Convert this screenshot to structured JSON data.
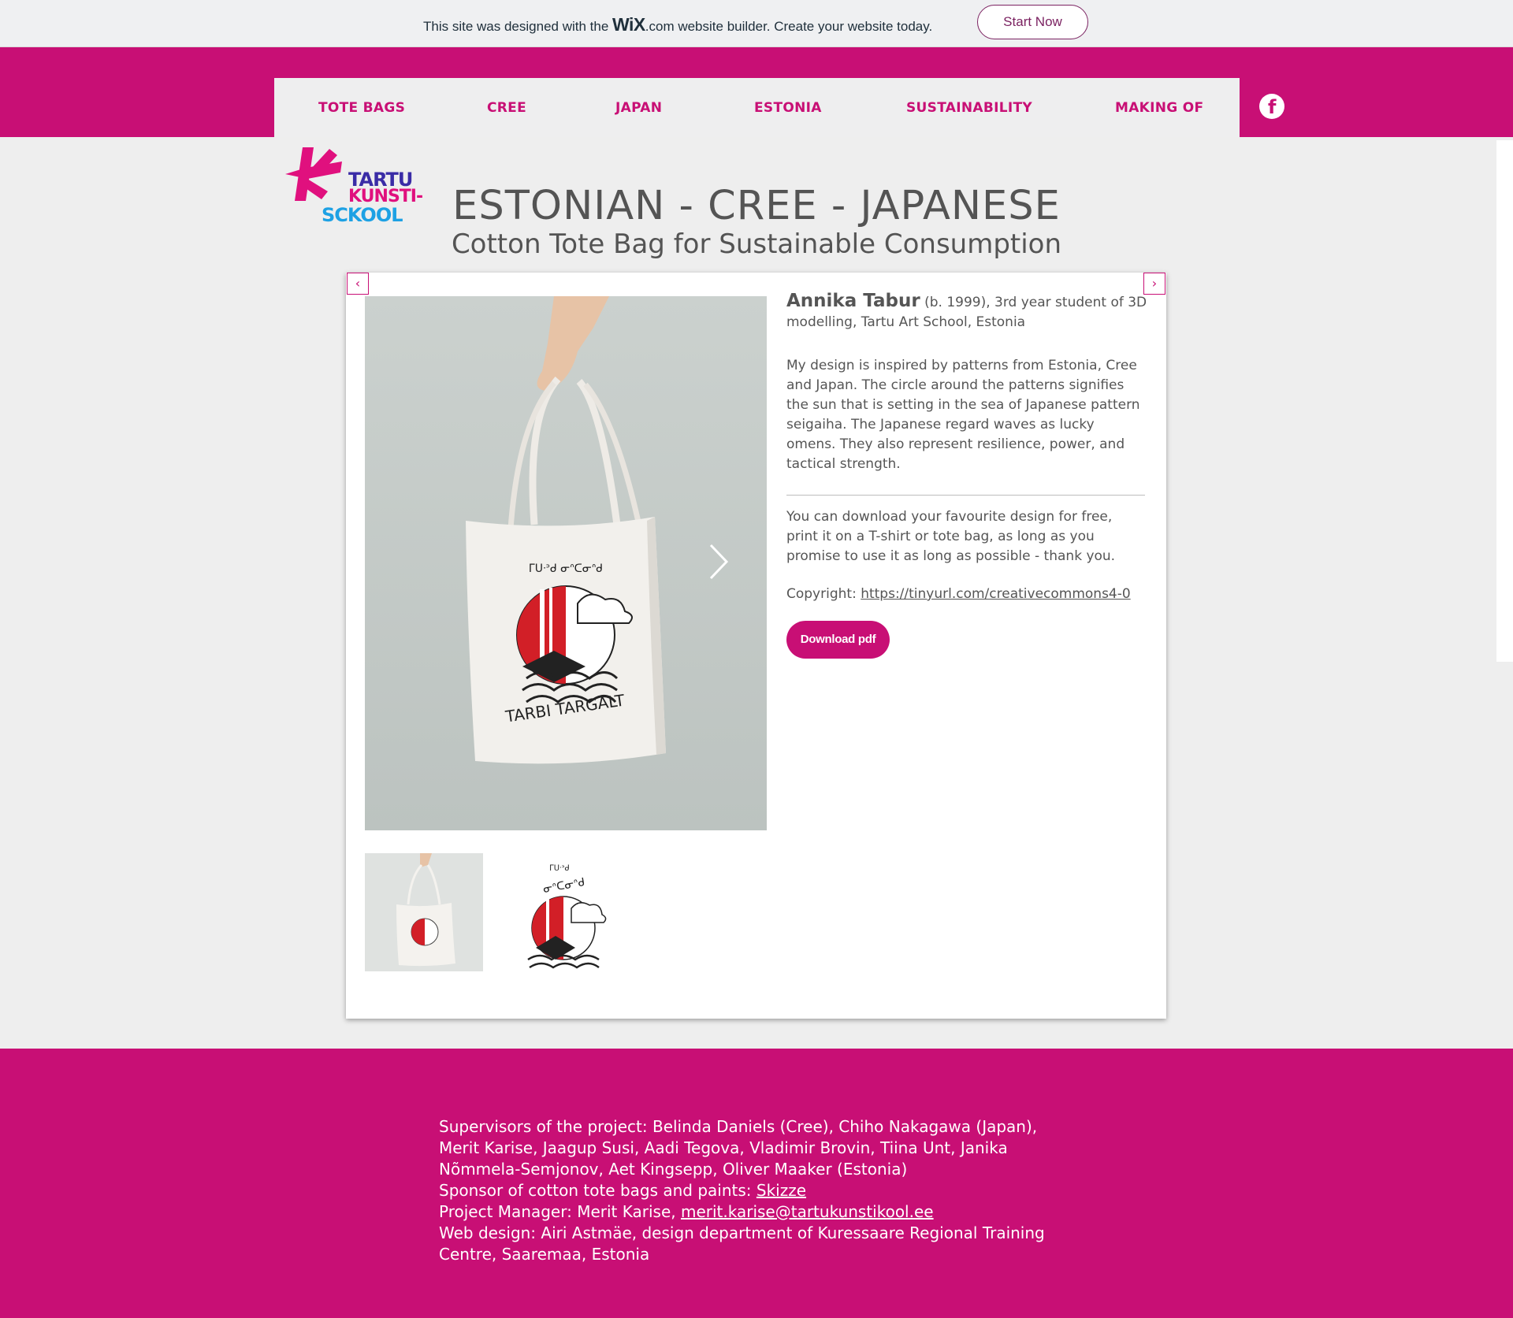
{
  "wix_banner": {
    "text_before": "This site was designed with the ",
    "logo": "WiX",
    "text_after": ".com website builder. Create your website today.",
    "button": "Start Now"
  },
  "nav": {
    "items": [
      "TOTE BAGS",
      "CREE",
      "JAPAN",
      "ESTONIA",
      "SUSTAINABILITY",
      "MAKING OF"
    ],
    "social_icon": "facebook-icon"
  },
  "logo": {
    "line1": "TARTU",
    "line2": "KUNSTI-",
    "line3": "SCKOOL"
  },
  "page": {
    "title": "ESTONIAN - CREE - JAPANESE",
    "subtitle": "Cotton Tote Bag for Sustainable Consumption"
  },
  "gallery": {
    "prev_icon": "chevron-left-icon",
    "next_icon": "chevron-right-icon",
    "bag_text": "TARBI TARGALT"
  },
  "artist": {
    "name": "Annika Tabur",
    "bio": " (b. 1999), 3rd year student of 3D modelling, Tartu Art School, Estonia",
    "description": "My design is inspired by patterns from Estonia, Cree and Japan. The circle around the patterns signifies the sun that is setting in the sea of Japanese pattern seigaiha. The Japanese regard waves as lucky omens. They also represent resilience, power, and tactical strength.",
    "download_note": "You can download your favourite design for free, print it on a T-shirt or tote bag, as long as you promise to use it as long as possible - thank you.",
    "copyright_label": "Copyright: ",
    "copyright_link": "https://tinyurl.com/creativecommons4-0",
    "download_button": "Download pdf"
  },
  "footer": {
    "supervisors": "Supervisors of the project: Belinda Daniels (Cree), Chiho Nakagawa (Japan), Merit Karise, Jaagup Susi, Aadi Tegova, Vladimir Brovin, Tiina Unt, Janika Nõmmela-Semjonov, Aet Kingsepp, Oliver Maaker (Estonia)",
    "sponsor_label": "Sponsor of cotton tote bags and paints: ",
    "sponsor_link": "Skizze",
    "manager_label": "Project Manager: Merit Karise, ",
    "manager_email": "merit.karise@tartukunstikool.ee",
    "web_design": "Web design: Airi Astmäe, design department of Kuressaare Regional Training Centre, Saaremaa, Estonia"
  },
  "colors": {
    "brand": "#c80f75",
    "background": "#eeeeee",
    "text": "#555555"
  }
}
